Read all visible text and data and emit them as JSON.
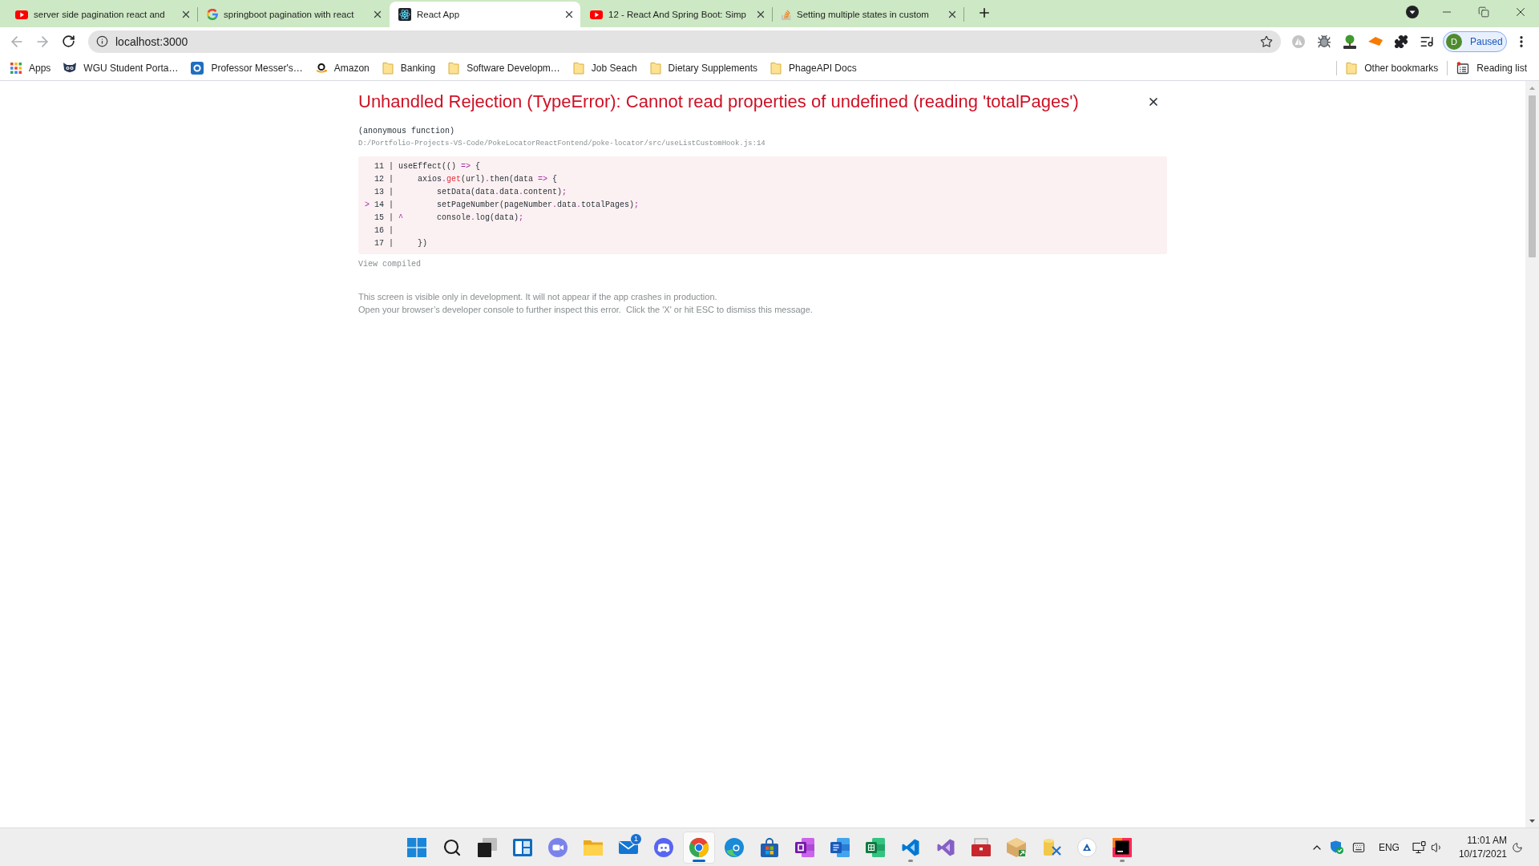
{
  "tabs": [
    {
      "title": "server side pagination react and",
      "selected": false
    },
    {
      "title": "springboot pagination with react",
      "selected": false
    },
    {
      "title": "React App",
      "selected": true
    },
    {
      "title": "12 - React And Spring Boot: Simp",
      "selected": false
    },
    {
      "title": "Setting multiple states in custom",
      "selected": false
    }
  ],
  "toolbar": {
    "back": {
      "disabled": true
    },
    "forward": {
      "disabled": true
    },
    "address": "localhost:3000",
    "profile": {
      "initial": "D",
      "status": "Paused"
    }
  },
  "bookmarks": {
    "items": [
      {
        "label": "Apps"
      },
      {
        "label": "WGU Student Porta…"
      },
      {
        "label": "Professor Messer's…"
      },
      {
        "label": "Amazon"
      },
      {
        "label": "Banking"
      },
      {
        "label": "Software Developm…"
      },
      {
        "label": "Job Seach"
      },
      {
        "label": "Dietary Supplements"
      },
      {
        "label": "PhageAPI Docs"
      }
    ],
    "other": {
      "label": "Other bookmarks"
    },
    "reading_list": {
      "label": "Reading list"
    }
  },
  "error_overlay": {
    "title": "Unhandled Rejection (TypeError): Cannot read properties of undefined (reading 'totalPages')",
    "frame": {
      "function": "(anonymous function)",
      "location": "D:/Portfolio-Projects-VS-Code/PokeLocatorReactFontend/poke-locator/src/useListCustomHook.js:14"
    },
    "code_lines": [
      {
        "gutter": "11 |",
        "tokens": [
          {
            "kind": "text",
            "text": "useEffect(() "
          },
          {
            "kind": "operator",
            "text": "=>"
          },
          {
            "kind": "text",
            "text": " {"
          }
        ]
      },
      {
        "gutter": "12 |",
        "tokens": [
          {
            "kind": "text",
            "text": "    axios"
          },
          {
            "kind": "operator",
            "text": "."
          },
          {
            "kind": "method",
            "text": "get"
          },
          {
            "kind": "text",
            "text": "(url)"
          },
          {
            "kind": "operator",
            "text": "."
          },
          {
            "kind": "text",
            "text": "then(data "
          },
          {
            "kind": "operator",
            "text": "=>"
          },
          {
            "kind": "text",
            "text": " {"
          }
        ]
      },
      {
        "gutter": "13 |",
        "tokens": [
          {
            "kind": "text",
            "text": "        setData(data"
          },
          {
            "kind": "operator",
            "text": "."
          },
          {
            "kind": "text",
            "text": "data"
          },
          {
            "kind": "operator",
            "text": "."
          },
          {
            "kind": "text",
            "text": "content)"
          },
          {
            "kind": "operator",
            "text": ";"
          }
        ]
      },
      {
        "marker": ">",
        "gutter": "14 |",
        "tokens": [
          {
            "kind": "text",
            "text": "        setPageNumber(pageNumber"
          },
          {
            "kind": "operator",
            "text": "."
          },
          {
            "kind": "text",
            "text": "data"
          },
          {
            "kind": "operator",
            "text": "."
          },
          {
            "kind": "text",
            "text": "totalPages)"
          },
          {
            "kind": "operator",
            "text": ";"
          }
        ]
      },
      {
        "gutter": "15 |",
        "tokens": [
          {
            "kind": "marker",
            "text": "^"
          },
          {
            "kind": "text",
            "text": "       console"
          },
          {
            "kind": "operator",
            "text": "."
          },
          {
            "kind": "text",
            "text": "log(data)"
          },
          {
            "kind": "operator",
            "text": ";"
          }
        ]
      },
      {
        "gutter": "16 |"
      },
      {
        "gutter": "17 |",
        "tokens": [
          {
            "kind": "text",
            "text": "    })"
          }
        ]
      }
    ],
    "view_compiled": "View compiled",
    "footer": [
      "This screen is visible only in development. It will not appear if the app crashes in production.",
      "Open your browser’s developer console to further inspect this error.  Click the 'X' or hit ESC to dismiss this message."
    ]
  },
  "taskbar": {
    "items": [
      {
        "selected": false,
        "running": false
      },
      {
        "selected": false,
        "running": false
      },
      {
        "selected": false,
        "running": false
      },
      {
        "selected": false,
        "running": false
      },
      {
        "selected": false,
        "running": false
      },
      {
        "selected": false,
        "running": false
      },
      {
        "selected": false,
        "running": false,
        "badge": "1"
      },
      {
        "selected": false,
        "running": false
      },
      {
        "selected": true,
        "running": true
      },
      {
        "selected": false,
        "running": false
      },
      {
        "selected": false,
        "running": false
      },
      {
        "selected": false,
        "running": false
      },
      {
        "selected": false,
        "running": false
      },
      {
        "selected": false,
        "running": false
      },
      {
        "selected": false,
        "running": true
      },
      {
        "selected": false,
        "running": false
      },
      {
        "selected": false,
        "running": false
      },
      {
        "selected": false,
        "running": false
      },
      {
        "selected": false,
        "running": false
      },
      {
        "selected": false,
        "running": false
      },
      {
        "selected": false,
        "running": true
      }
    ],
    "tray": {
      "language": "ENG",
      "time": "11:01 AM",
      "date": "10/17/2021"
    }
  }
}
